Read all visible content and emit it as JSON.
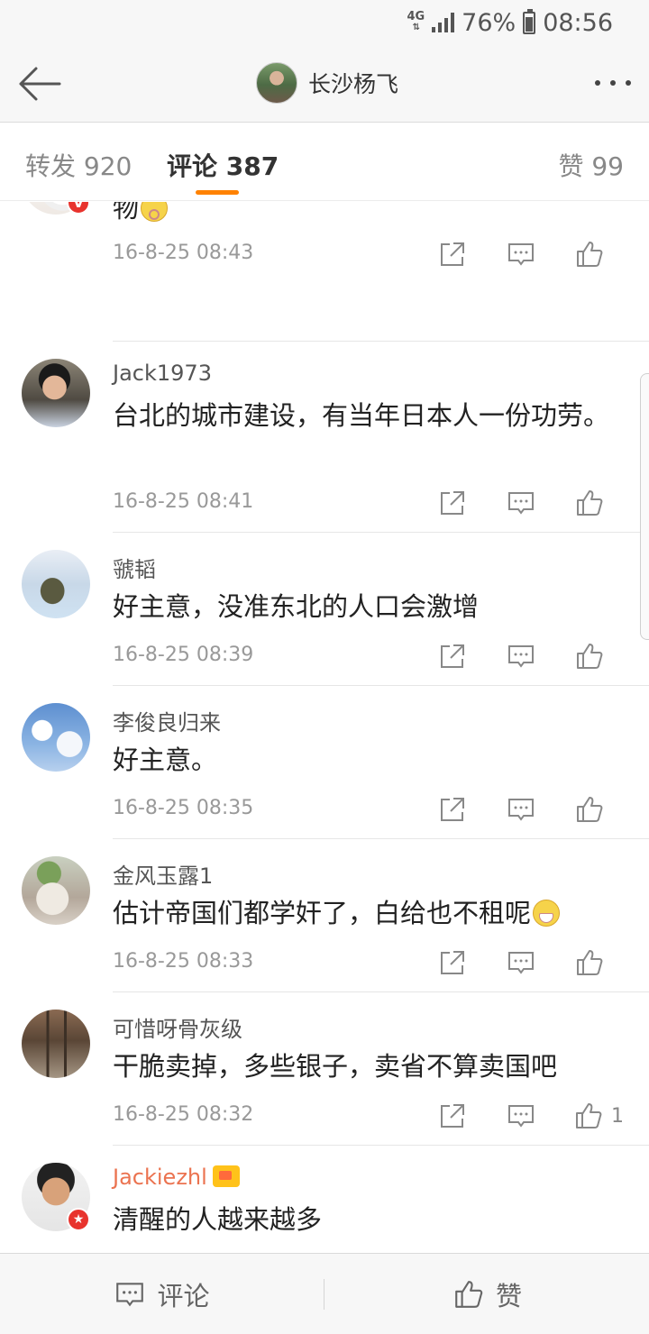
{
  "status_bar": {
    "network": "4G",
    "battery": "76%",
    "battery_level": 0.76,
    "time": "08:56"
  },
  "header": {
    "title": "长沙杨飞",
    "back_icon": "arrow-left-icon",
    "more_icon": "more-horizontal-icon"
  },
  "tabs": {
    "repost": "转发 920",
    "comments": "评论 387",
    "likes": "赞 99",
    "active": "comments",
    "accent": "#ff8200"
  },
  "comments": [
    {
      "name": "",
      "text": "说这种不负责任的话的人估计是中日友好的产物",
      "emoji": "sick",
      "time": "16-8-25 08:43",
      "likes": "",
      "verified": "V"
    },
    {
      "name": "Jack1973",
      "text": "台北的城市建设，有当年日本人一份功劳。",
      "time": "16-8-25 08:41",
      "likes": ""
    },
    {
      "name": "虢韬",
      "text": "好主意，没准东北的人口会激增",
      "time": "16-8-25 08:39",
      "likes": ""
    },
    {
      "name": "李俊良归来",
      "text": "好主意。",
      "time": "16-8-25 08:35",
      "likes": ""
    },
    {
      "name": "金风玉露1",
      "text": "估计帝国们都学奸了，白给也不租呢",
      "emoji": "grin",
      "time": "16-8-25 08:33",
      "likes": ""
    },
    {
      "name": "可惜呀骨灰级",
      "text": "干脆卖掉，多些银子，卖省不算卖国吧",
      "time": "16-8-25 08:32",
      "likes": "1"
    },
    {
      "name": "Jackiezhl",
      "text": "清醒的人越来越多",
      "time": "",
      "likes": "",
      "vip_color": "#eb7350"
    }
  ],
  "bottom_bar": {
    "comment_label": "评论",
    "like_label": "赞",
    "comment_icon": "comment-icon",
    "like_icon": "thumbs-up-icon"
  }
}
